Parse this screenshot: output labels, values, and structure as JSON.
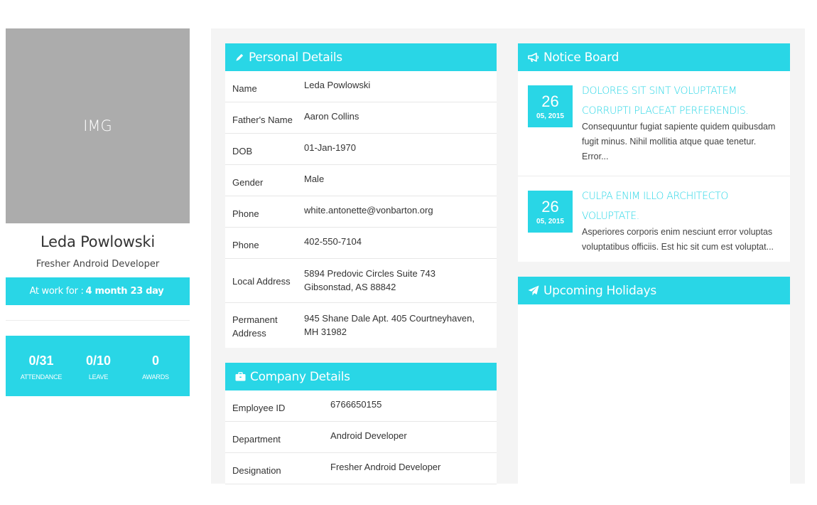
{
  "profile": {
    "image_placeholder": "IMG",
    "name": "Leda Powlowski",
    "role": "Fresher Android Developer",
    "work_label": "At work for :",
    "work_value": "4 month 23 day",
    "stats": [
      {
        "value": "0/31",
        "label": "ATTENDANCE"
      },
      {
        "value": "0/10",
        "label": "LEAVE"
      },
      {
        "value": "0",
        "label": "AWARDS"
      }
    ]
  },
  "personal": {
    "title": "Personal Details",
    "rows": [
      {
        "key": "Name",
        "value": "Leda Powlowski"
      },
      {
        "key": "Father's Name",
        "value": "Aaron Collins"
      },
      {
        "key": "DOB",
        "value": "01-Jan-1970"
      },
      {
        "key": "Gender",
        "value": "Male"
      },
      {
        "key": "Phone",
        "value": "white.antonette@vonbarton.org"
      },
      {
        "key": "Phone",
        "value": "402-550-7104"
      },
      {
        "key": "Local Address",
        "value": "5894 Predovic Circles Suite 743 Gibsonstad, AS 88842"
      },
      {
        "key": "Permanent Address",
        "value": "945 Shane Dale Apt. 405 Courtneyhaven, MH 31982"
      }
    ]
  },
  "company": {
    "title": "Company Details",
    "rows": [
      {
        "key": "Employee ID",
        "value": "6766650155"
      },
      {
        "key": "Department",
        "value": "Android Developer"
      },
      {
        "key": "Designation",
        "value": "Fresher Android Developer"
      }
    ]
  },
  "notice": {
    "title": "Notice Board",
    "items": [
      {
        "day": "26",
        "month_year": "05, 2015",
        "title": "DOLORES SIT SINT VOLUPTATEM CORRUPTI PLACEAT PERFERENDIS.",
        "text": "Consequuntur fugiat sapiente quidem quibusdam fugit minus. Nihil mollitia atque quae tenetur. Error..."
      },
      {
        "day": "26",
        "month_year": "05, 2015",
        "title": "CULPA ENIM ILLO ARCHITECTO VOLUPTATE.",
        "text": "Asperiores corporis enim nesciunt error voluptas voluptatibus officiis. Est hic sit cum est voluptat..."
      }
    ]
  },
  "holidays": {
    "title": "Upcoming Holidays"
  },
  "colors": {
    "accent": "#29d6e6",
    "placeholder_gray": "#acacac",
    "panel_bg": "#f4f4f4"
  }
}
